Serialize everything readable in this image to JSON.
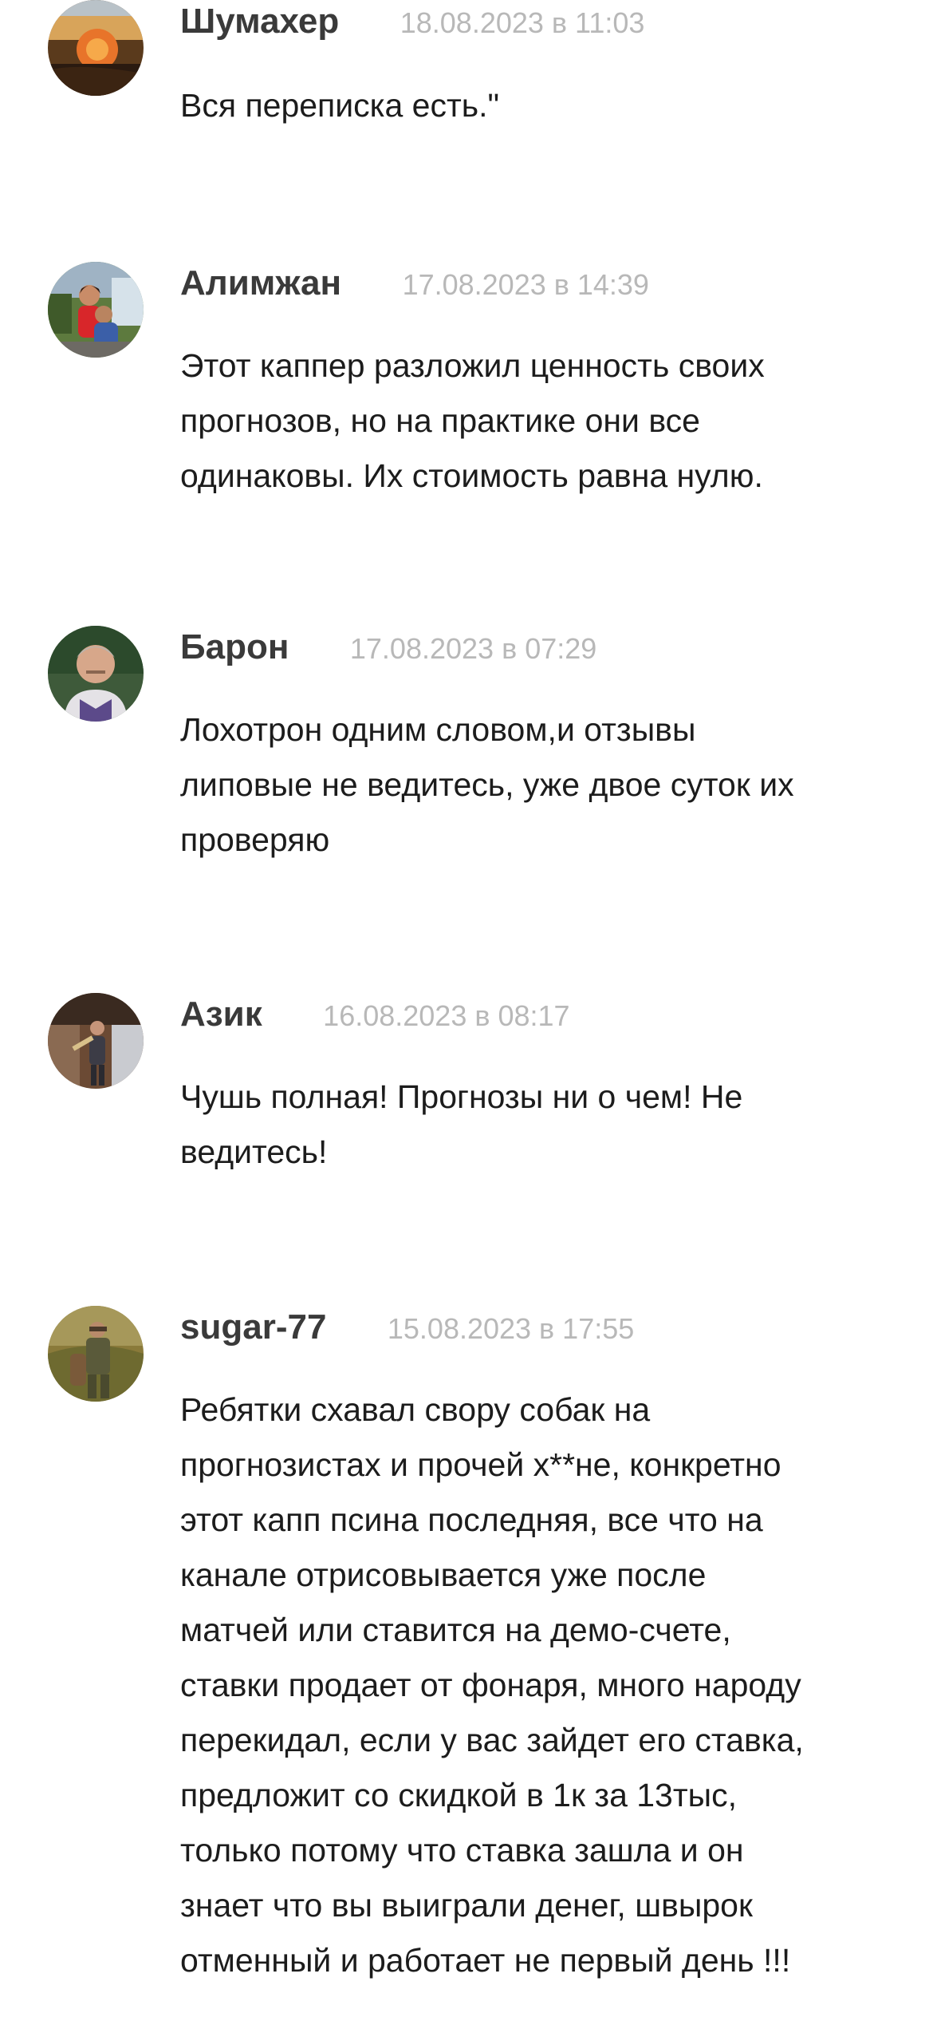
{
  "comments": [
    {
      "author": "Шумахер",
      "date": "18.08.2023 в 11:03",
      "lines": [
        "Вся переписка есть.\""
      ],
      "avatar_icon": "sunset-photo-avatar"
    },
    {
      "author": "Алимжан",
      "date": "17.08.2023 в 14:39",
      "lines": [
        "Этот каппер разложил ценность своих",
        "прогнозов, но на практике они все",
        "одинаковы. Их стоимость равна нулю."
      ],
      "avatar_icon": "couple-photo-avatar"
    },
    {
      "author": "Барон",
      "date": "17.08.2023 в 07:29",
      "lines": [
        "Лохотрон одним словом,и отзывы",
        "липовые не ведитесь, уже двое суток их",
        "проверяю"
      ],
      "avatar_icon": "man-portrait-avatar"
    },
    {
      "author": "Азик",
      "date": "16.08.2023 в 08:17",
      "lines": [
        "Чушь полная! Прогнозы ни о чем! Не",
        "ведитесь!"
      ],
      "avatar_icon": "man-standing-avatar"
    },
    {
      "author": "sugar-77",
      "date": "15.08.2023 в 17:55",
      "lines": [
        "Ребятки схавал свору собак на",
        "прогнозистах и прочей х**не, конкретно",
        "этот капп псина последняя, все что на",
        "канале отрисовывается уже после",
        "матчей или ставится на демо-счете,",
        "ставки продает от фонаря, много народу",
        "перекидал, если у вас зайдет его ставка,",
        "предложит со скидкой в 1к за 13тыс,",
        "только потому что ставка зашла и он",
        "знает что вы выиграли денег, швырок",
        "отменный и работает не первый день !!!"
      ],
      "avatar_icon": "hunter-photo-avatar"
    }
  ],
  "colors": {
    "author": "#3a3a3a",
    "date": "#b8b8b8",
    "text": "#1c1c1c",
    "background": "#ffffff"
  }
}
